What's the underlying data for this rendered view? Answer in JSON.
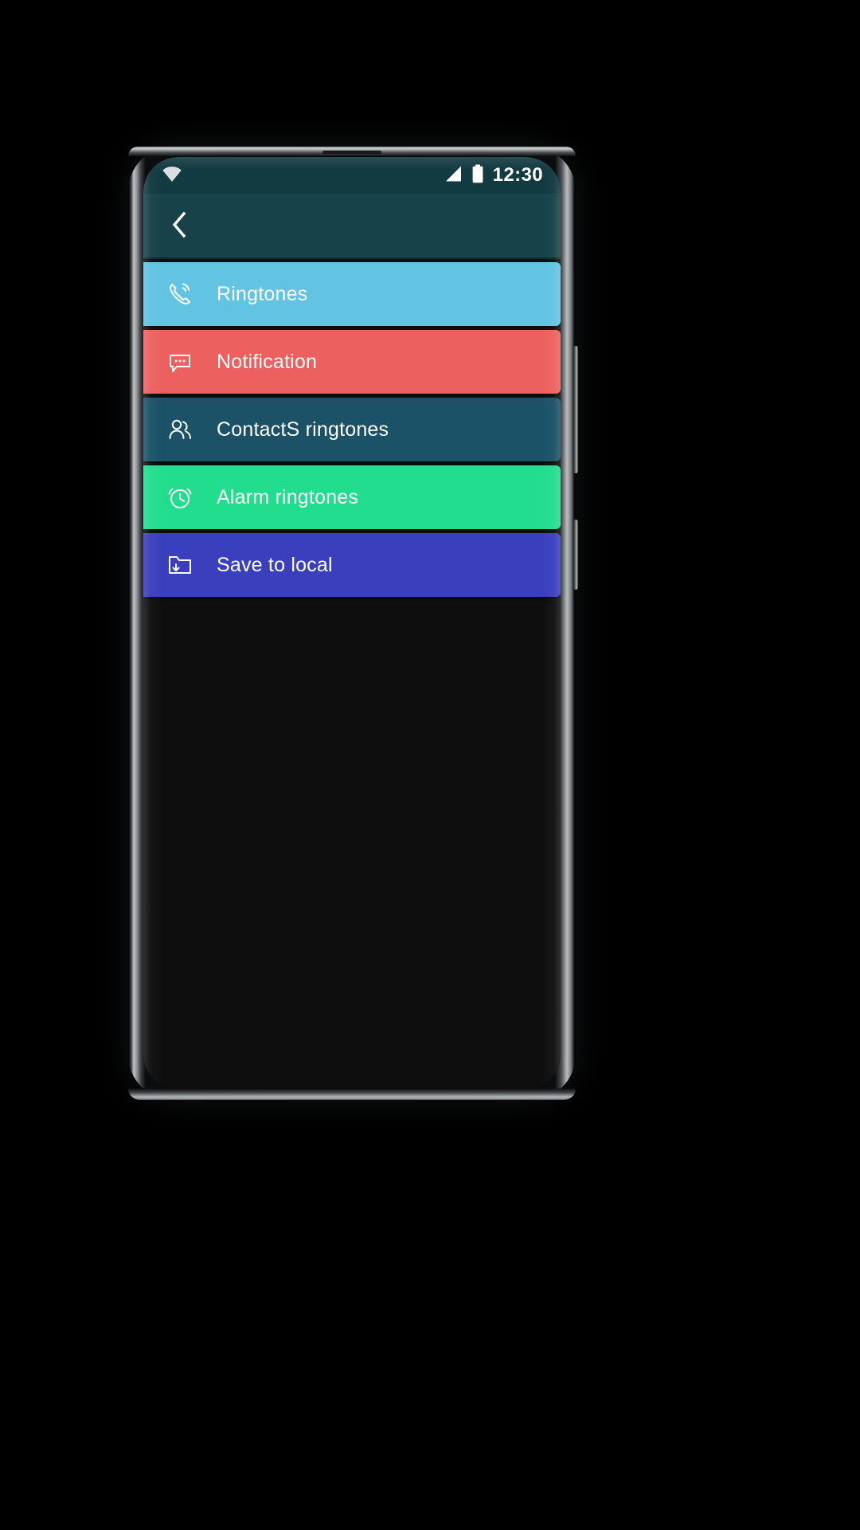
{
  "statusbar": {
    "wifi_icon": "wifi-icon",
    "signal_icon": "signal-icon",
    "battery_icon": "battery-icon",
    "time": "12:30"
  },
  "appbar": {
    "back_icon": "back-chevron-icon",
    "title": ""
  },
  "list": {
    "items": [
      {
        "label": "Ringtones",
        "icon": "phone-ringing-icon",
        "bg": "#63C3E3"
      },
      {
        "label": "Notification",
        "icon": "chat-bubble-icon",
        "bg": "#EC6160"
      },
      {
        "label": "ContactS ringtones",
        "icon": "contacts-people-icon",
        "bg": "#1B5267"
      },
      {
        "label": "Alarm ringtones",
        "icon": "alarm-clock-icon",
        "bg": "#23DD8E"
      },
      {
        "label": "Save to local",
        "icon": "folder-download-icon",
        "bg": "#3A3FBD"
      }
    ]
  },
  "theme": {
    "statusbar_bg": "#123A41",
    "appbar_bg": "#174249",
    "content_bg": "#0E0E0F",
    "page_bg": "#000000",
    "text": "#FFFFFF"
  }
}
